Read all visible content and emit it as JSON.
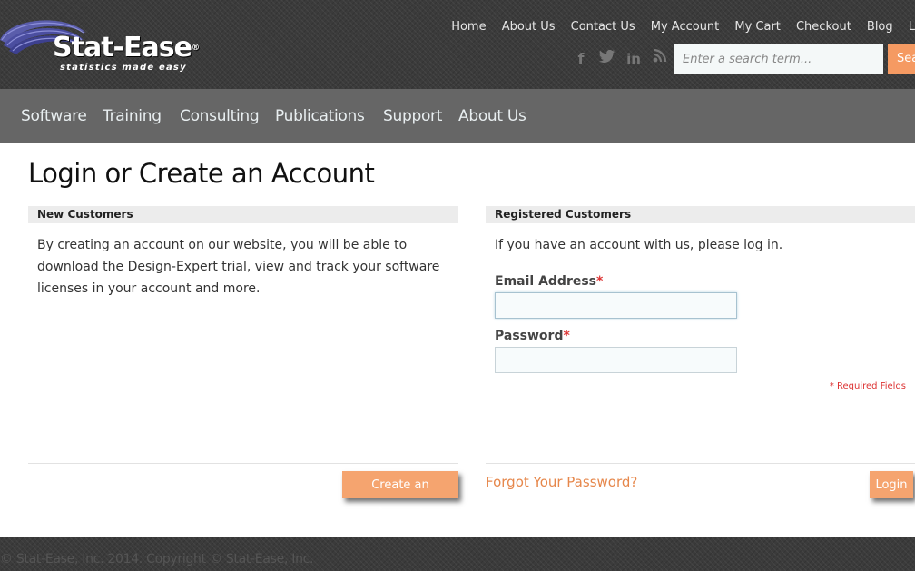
{
  "header": {
    "logo": {
      "name": "Stat-Ease",
      "tagline": "statistics made easy"
    },
    "top_nav": [
      "Home",
      "About Us",
      "Contact Us",
      "My Account",
      "My Cart",
      "Checkout",
      "Blog",
      "L"
    ],
    "social_icons": [
      "facebook-icon",
      "twitter-icon",
      "linkedin-icon",
      "blog-icon"
    ],
    "search": {
      "placeholder": "Enter a search term...",
      "button_label": "Sea"
    }
  },
  "main_nav": [
    "Software",
    "Training",
    "Consulting",
    "Publications",
    "Support",
    "About Us"
  ],
  "page": {
    "title": "Login or Create an Account",
    "new_customers": {
      "heading": "New Customers",
      "text": "By creating an account on our website, you will be able to download the Design-Expert trial, view and track your software licenses in your account and more.",
      "create_button": "Create an Account"
    },
    "registered": {
      "heading": "Registered Customers",
      "intro": "If you have an account with us, please log in.",
      "email_label": "Email Address",
      "password_label": "Password",
      "required_marker": "*",
      "email_value": "",
      "password_value": "",
      "required_note": "* Required Fields",
      "forgot_link": "Forgot Your Password?",
      "login_button": "Login"
    }
  },
  "footer": {
    "text": "© Stat-Ease, Inc. 2014.  Copyright © Stat-Ease, Inc."
  },
  "colors": {
    "accent": "#f5a46f",
    "link": "#e6874b",
    "nav_bg": "#666666",
    "header_bg": "#3b3b3b",
    "required": "#dd3333"
  }
}
